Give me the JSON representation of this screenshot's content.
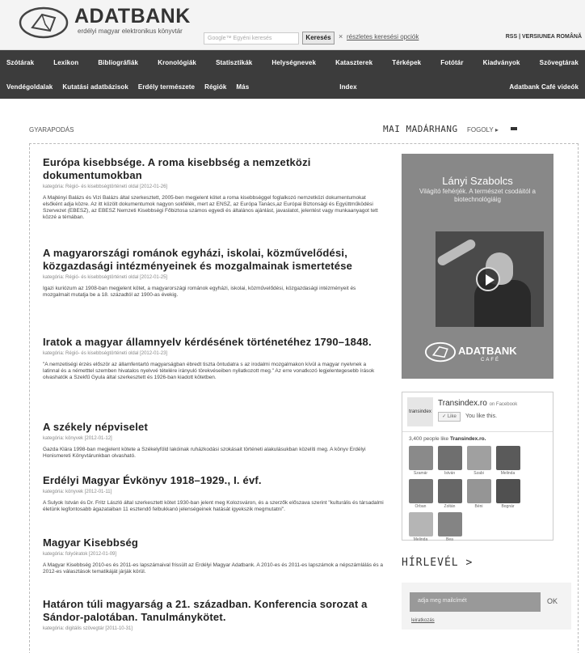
{
  "header": {
    "logo_title": "ADATBANK",
    "logo_subtitle": "erdélyi magyar elektronikus könyvtár",
    "search_placeholder": "Google™ Egyéni keresés",
    "search_button": "Keresés",
    "close_symbol": "×",
    "advanced_search": "részletes keresési opciók",
    "top_right_links": "RSS | VERSIUNEA ROMÂNĂ"
  },
  "nav": {
    "row1": [
      "Szótárak",
      "Lexikon",
      "Bibliográfiák",
      "Kronológiák",
      "Statisztikák",
      "Helységnevek",
      "Kataszterek",
      "Térképek",
      "Fotótár",
      "Kiadványok",
      "Szövegtárak"
    ],
    "row2": [
      "Vendégoldalak",
      "Kutatási adatbázisok",
      "Erdély természete",
      "Régiók",
      "Más",
      "Index",
      "Adatbank Café videók"
    ]
  },
  "main": {
    "section_label": "GYARAPODÁS",
    "articles": [
      {
        "title": "Európa kisebbsége. A roma kisebbség a nemzetközi dokumentumokban",
        "meta": "kategória: Régió- és kisebbségtörténeti oldal [2012-01-26]",
        "body": "A Majtényi Balázs és Vizi Balázs által szerkesztett, 2005-ben megjelent kötet a roma kisebbséggel foglalkozó nemzetközi dokumentumokat elsőként adja közre. Az itt közölt dokumentumok nagyon sokfélék, mert az ENSZ, az Európa Tanács,az Európai Biztonsági és Együttműködési Szervezet (EBESZ), az EBESZ Nemzeti Kisebbségi Főbiztosa számos egyedi és általános ajánlást, javaslatot, jelentést vagy munkaanyagot tett közzé a témában."
      },
      {
        "title": "A magyarországi románok egyházi, iskolai, közművelődési, közgazdasági intézményeinek és mozgalmainak ismertetése",
        "meta": "kategória: Régió- és kisebbségtörténeti oldal [2012-01-25]",
        "body": "Igazi kuriózum az 1908-ban megjelent kötet, a magyarországi románok egyházi, iskolai, közművelődési, közgazdasági intézményeit és mozgalmait mutatja be a 18. századtól az 1900-as évekig."
      },
      {
        "title": "Iratok a magyar államnyelv kérdésének történetéhez 1790–1848.",
        "meta": "kategória: Régió- és kisebbségtörténeti oldal [2012-01-23]",
        "body": "\"A nemzetiségi érzés először az államfentartó magyarságban ébredt tiszta öntudatra s az irodalmi mozgalmakon kívül a magyar nyelvnek a latinnal és a németttel szemben hivatalos nyelvvé tételére irányuló törekvéseiben nyilatkozott meg.\" Az erre vonatkozó legjelentegesebb írások olvashatók a Szekfű Gyula által szerkesztett és 1926-ban kiadott kötetben."
      },
      {
        "title": "A székely népviselet",
        "meta": "kategória: könyvek [2012-01-12]",
        "body": "Gazda Klára 1998-ban megjelent kötete a Székelyföld lakóinak ruházkodási szokásait történeti alakulásukban közelíti meg. A könyv Erdélyi Honismereti Könyvtárunkban olvasható."
      },
      {
        "title": "Erdélyi Magyar Évkönyv 1918–1929., I. évf.",
        "meta": "kategória: könyvek [2012-01-11]",
        "body": "A Sulyok István és Dr. Fritz László által szerkesztett kötet 1930-ban jelent meg Kolozsváron, és a szerzők előszava szerint \"kulturális és társadalmi életünk legfontosabb ágazataiban 11 esztendő felbukkanó jelenségeinek hatását igyekszik megmutatni\"."
      },
      {
        "title": "Magyar Kisebbség",
        "meta": "kategória: folyóiratok [2012-01-09]",
        "body": "A Magyar Kisebbség 2010-es és 2011-es lapszámaival frissült az Erdélyi Magyar Adatbank. A 2010-es és 2011-es lapszámok a népszámlálás és a 2012-es választások tematikáját járják körül."
      },
      {
        "title": "Határon túli magyarság a 21. században. Konferencia sorozat a Sándor-palotában. Tanulmánykötet.",
        "meta": "kategória: digitális szövegtár [2011-10-31]",
        "body": ""
      }
    ]
  },
  "sidebar": {
    "bird_label": "MAI MADÁRHANG",
    "bird_name": "FOGOLY ▸",
    "video": {
      "name": "Lányi Szabolcs",
      "subtitle": "Világító fehérjék. A természet csodáitól a biotechnológiáig",
      "brand": "ADATBANK",
      "brand_sub": "CAFÉ"
    },
    "facebook": {
      "logo_text": "transindex",
      "page_name": "Transindex.ro",
      "on_facebook": "on Facebook",
      "like_button": "✓ Like",
      "liked_text": "You like this.",
      "count_prefix": "3,400 people like",
      "count_page": "Transindex.ro.",
      "faces": [
        "Szamár",
        "István",
        "Szabi",
        "Melinda",
        "Orban",
        "Zoltán",
        "Béni",
        "Bognár",
        "Melinda",
        "Bea"
      ]
    },
    "newsletter": {
      "label": "HÍRLEVÉL >",
      "placeholder": "adja meg mailcímét",
      "ok": "OK",
      "unsubscribe": "leiratkozás"
    }
  }
}
